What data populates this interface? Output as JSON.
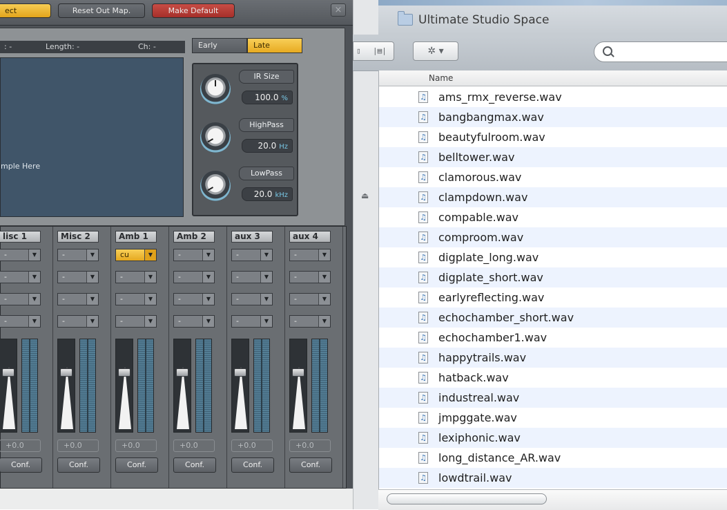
{
  "plugin": {
    "top_buttons": {
      "select": "ect",
      "reset": "Reset Out Map.",
      "make_default": "Make Default",
      "close": "×"
    },
    "info": {
      "field1": ": -",
      "length": "Length: -",
      "channels": "Ch: -"
    },
    "drop_text": "mple Here",
    "tabs": {
      "early": "Early",
      "late": "Late",
      "active": "late"
    },
    "knobs": [
      {
        "label": "IR Size",
        "value": "100.0",
        "unit": "%"
      },
      {
        "label": "HighPass",
        "value": "20.0",
        "unit": "Hz"
      },
      {
        "label": "LowPass",
        "value": "20.0",
        "unit": "kHz"
      }
    ],
    "strips": [
      {
        "name": "lisc 1",
        "dd": [
          "-",
          "-",
          "-",
          "-"
        ],
        "vol": "+0.0",
        "conf": "Conf."
      },
      {
        "name": "Misc 2",
        "dd": [
          "-",
          "-",
          "-",
          "-"
        ],
        "vol": "+0.0",
        "conf": "Conf."
      },
      {
        "name": "Amb 1",
        "dd": [
          "cu",
          "-",
          "-",
          "-"
        ],
        "vol": "+0.0",
        "conf": "Conf."
      },
      {
        "name": "Amb 2",
        "dd": [
          "-",
          "-",
          "-",
          "-"
        ],
        "vol": "+0.0",
        "conf": "Conf."
      },
      {
        "name": "aux 3",
        "dd": [
          "-",
          "-",
          "-",
          "-"
        ],
        "vol": "+0.0",
        "conf": "Conf."
      },
      {
        "name": "aux 4",
        "dd": [
          "-",
          "-",
          "-",
          "-"
        ],
        "vol": "+0.0",
        "conf": "Conf."
      }
    ],
    "colors": {
      "accent_yellow": "#f2c244",
      "accent_red": "#b83a33",
      "drop_area": "#405569"
    }
  },
  "finder": {
    "title": "Ultimate Studio Space",
    "toolbar": {
      "action_glyph": "✲ ▾",
      "search_placeholder": ""
    },
    "column": "Name",
    "files": [
      "ams_rmx_reverse.wav",
      "bangbangmax.wav",
      "beautyfulroom.wav",
      "belltower.wav",
      "clamorous.wav",
      "clampdown.wav",
      "compable.wav",
      "comproom.wav",
      "digplate_long.wav",
      "digplate_short.wav",
      "earlyreflecting.wav",
      "echochamber_short.wav",
      "echochamber1.wav",
      "happytrails.wav",
      "hatback.wav",
      "industreal.wav",
      "jmpggate.wav",
      "lexiphonic.wav",
      "long_distance_AR.wav",
      "lowdtrail.wav"
    ],
    "colors": {
      "row_alt": "#edf3fe",
      "audio_icon": "#3f78b7"
    }
  }
}
